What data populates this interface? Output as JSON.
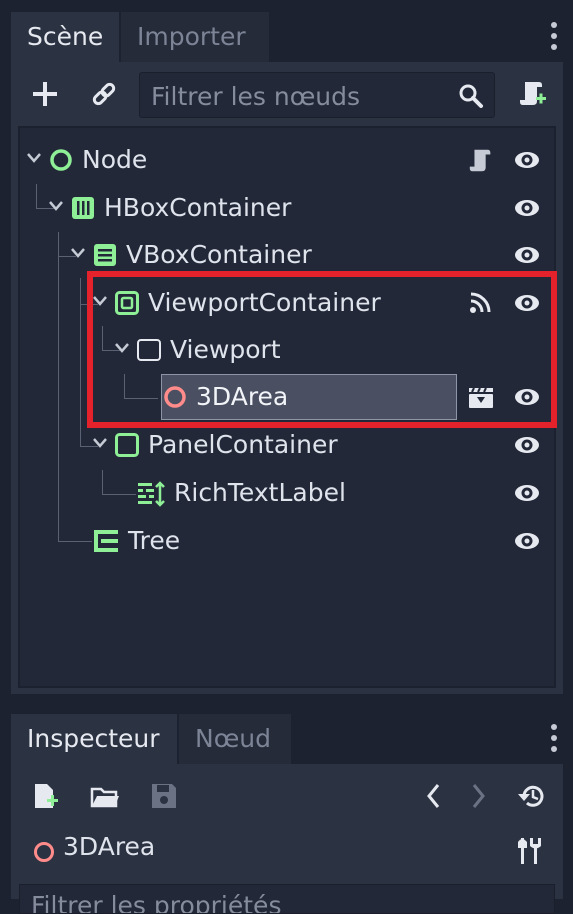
{
  "scene_dock": {
    "tabs": [
      {
        "label": "Scène",
        "active": true
      },
      {
        "label": "Importer",
        "active": false
      }
    ],
    "toolbar": {
      "add_icon": "plus-icon",
      "link_icon": "link-icon",
      "filter_placeholder": "Filtrer les nœuds",
      "search_icon": "search-icon",
      "script_icon": "script-add-icon"
    },
    "tree": [
      {
        "label": "Node",
        "icon": "node-circle-icon",
        "extra_icon": "script-icon"
      },
      {
        "label": "HBoxContainer",
        "icon": "hbox-icon"
      },
      {
        "label": "VBoxContainer",
        "icon": "vbox-icon"
      },
      {
        "label": "ViewportContainer",
        "icon": "viewport-container-icon",
        "extra_icon": "signal-icon"
      },
      {
        "label": "Viewport",
        "icon": "viewport-icon"
      },
      {
        "label": "3DArea",
        "icon": "node-circle-red-icon",
        "extra_icon": "clapperboard-icon",
        "selected": true
      },
      {
        "label": "PanelContainer",
        "icon": "panel-container-icon"
      },
      {
        "label": "RichTextLabel",
        "icon": "rich-text-label-icon"
      },
      {
        "label": "Tree",
        "icon": "tree-icon"
      }
    ]
  },
  "inspector_dock": {
    "tabs": [
      {
        "label": "Inspecteur",
        "active": true
      },
      {
        "label": "Nœud",
        "active": false
      }
    ],
    "selected_node": "3DArea",
    "filter_placeholder": "Filtrer les propriétés"
  },
  "colors": {
    "accent_green": "#8eef97",
    "node_red": "#ff8b8b",
    "highlight_red": "#e3222b"
  }
}
